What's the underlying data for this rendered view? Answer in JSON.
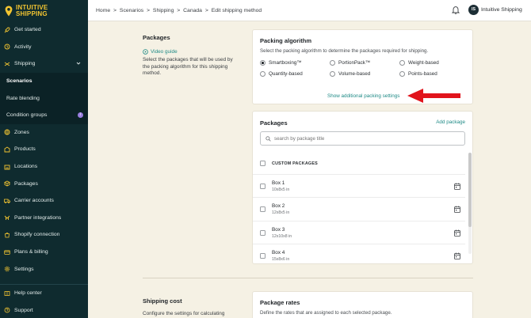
{
  "brand": {
    "line1": "INTUITIVE",
    "line2": "SHIPPING",
    "accent": "#f3c531",
    "sidebar_bg": "#0f2b2f"
  },
  "sidebar": {
    "items": [
      {
        "label": "Get started",
        "icon": "rocket-icon"
      },
      {
        "label": "Activity",
        "icon": "activity-icon"
      },
      {
        "label": "Shipping",
        "icon": "shipping-icon"
      },
      {
        "label": "Scenarios"
      },
      {
        "label": "Rate blending"
      },
      {
        "label": "Condition groups",
        "badge": "i"
      },
      {
        "label": "Zones",
        "icon": "zones-icon"
      },
      {
        "label": "Products",
        "icon": "products-icon"
      },
      {
        "label": "Locations",
        "icon": "locations-icon"
      },
      {
        "label": "Packages",
        "icon": "packages-icon"
      },
      {
        "label": "Carrier accounts",
        "icon": "carrier-icon"
      },
      {
        "label": "Partner integrations",
        "icon": "partner-icon"
      },
      {
        "label": "Shopify connection",
        "icon": "shopify-icon"
      },
      {
        "label": "Plans & billing",
        "icon": "billing-icon"
      },
      {
        "label": "Settings",
        "icon": "gear-icon"
      }
    ],
    "bottom": [
      {
        "label": "Help center",
        "icon": "help-icon"
      },
      {
        "label": "Support",
        "icon": "support-icon"
      }
    ]
  },
  "topbar": {
    "breadcrumb": [
      "Home",
      "Scenarios",
      "Shipping",
      "Canada",
      "Edit shipping method"
    ],
    "separator": ">",
    "avatar_initials": "IS",
    "company": "Intuitive Shipping"
  },
  "packages_section": {
    "title": "Packages",
    "video_guide": "Video guide",
    "description": "Select the packages that will be used by the packing algorithm for this shipping method."
  },
  "packing_algorithm": {
    "title": "Packing algorithm",
    "subtitle": "Select the packing algorithm to determine the packages required for shipping.",
    "options": [
      "Smartboxing™",
      "PortionPack™",
      "Weight-based",
      "Quantity-based",
      "Volume-based",
      "Points-based"
    ],
    "selected": "Smartboxing™",
    "more_link": "Show additional packing settings"
  },
  "packages_card": {
    "title": "Packages",
    "add_link": "Add package",
    "search_placeholder": "search by package title",
    "group_header": "CUSTOM PACKAGES",
    "rows": [
      {
        "name": "Box 1",
        "dims": "10x8x5 in"
      },
      {
        "name": "Box 2",
        "dims": "12x8x5 in"
      },
      {
        "name": "Box 3",
        "dims": "12x10x8 in"
      },
      {
        "name": "Box 4",
        "dims": "15x8x6 in"
      }
    ]
  },
  "shipping_cost": {
    "title": "Shipping cost",
    "description": "Configure the settings for calculating"
  },
  "package_rates": {
    "title": "Package rates",
    "subtitle": "Define the rates that are assigned to each selected package."
  }
}
